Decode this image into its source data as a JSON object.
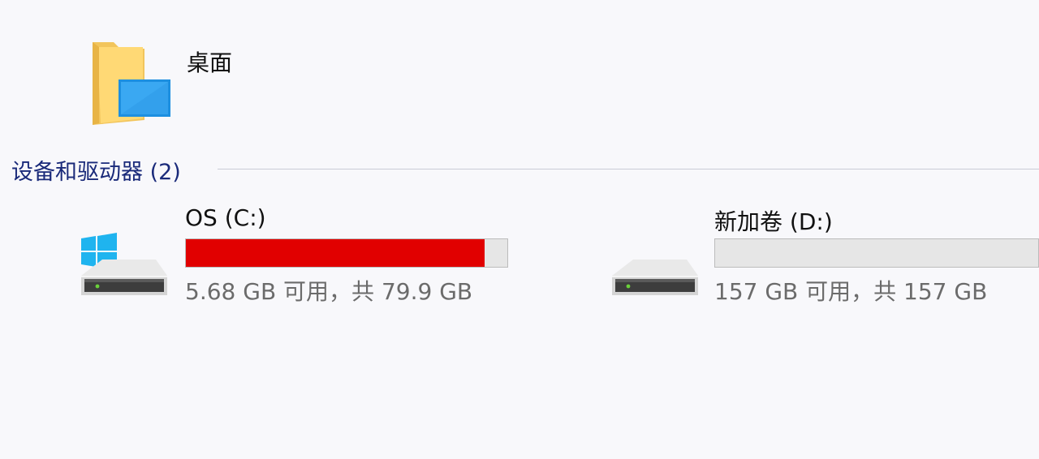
{
  "desktop_item": {
    "label": "桌面",
    "icon": "desktop-folder-icon"
  },
  "section": {
    "title": "设备和驱动器 (2)"
  },
  "drives": [
    {
      "name": "OS (C:)",
      "space_text": "5.68 GB 可用，共 79.9 GB",
      "used_fraction": 0.929,
      "bar_color": "#e10000",
      "icon": "windows-drive-icon"
    },
    {
      "name": "新加卷 (D:)",
      "space_text": "157 GB 可用，共 157 GB",
      "used_fraction": 0.0,
      "bar_color": "#26a0da",
      "icon": "drive-icon"
    }
  ],
  "colors": {
    "background": "#f8f8fb",
    "section_title": "#1a2a7a",
    "bar_track": "#e6e6e6",
    "bar_full_warning": "#e10000"
  }
}
